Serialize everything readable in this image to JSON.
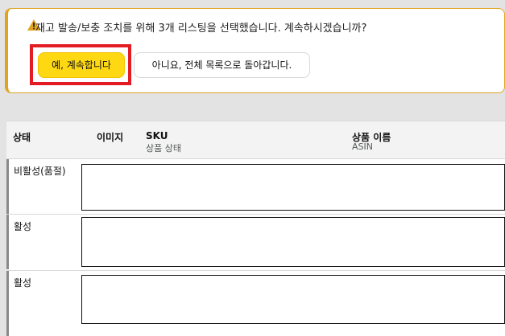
{
  "alert": {
    "icon": "warning-icon",
    "message": "재고 발송/보충 조치를 위해 3개 리스팅을 선택했습니다. 계속하시겠습니까?",
    "confirm_label": "예, 계속합니다",
    "cancel_label": "아니요, 전체 목록으로 돌아갑니다.",
    "accent_color": "#e0a320",
    "confirm_color": "#ffd814",
    "highlight_color": "#e31b23"
  },
  "table": {
    "headers": {
      "status": "상태",
      "image": "이미지",
      "sku": "SKU",
      "sku_sub": "상품 상태",
      "name": "상품 이름",
      "name_sub": "ASIN"
    },
    "rows": [
      {
        "status": "비활성(품절)"
      },
      {
        "status": "활성"
      },
      {
        "status": "활성"
      }
    ]
  }
}
